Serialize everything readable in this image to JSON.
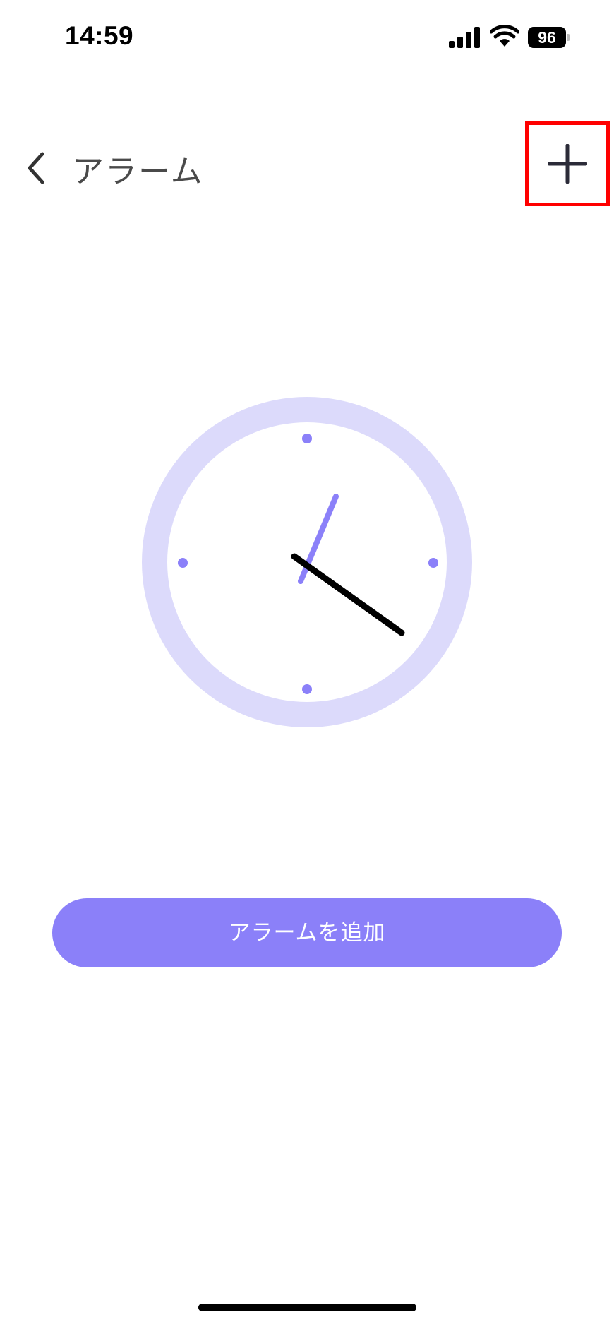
{
  "status_bar": {
    "time": "14:59",
    "battery_level": "96",
    "icons": [
      "signal-icon",
      "wifi-icon",
      "battery-icon"
    ]
  },
  "header": {
    "back_icon": "chevron-left-icon",
    "title": "アラーム",
    "add_icon": "plus-icon",
    "highlight_color": "#ff0000"
  },
  "illustration": {
    "type": "clock-illustration",
    "ring_color": "#dcdafb",
    "accent_color": "#8b80f9",
    "minute_hand_color": "#000000"
  },
  "main": {
    "add_alarm_label": "アラームを追加",
    "button_color": "#8b80f9"
  }
}
